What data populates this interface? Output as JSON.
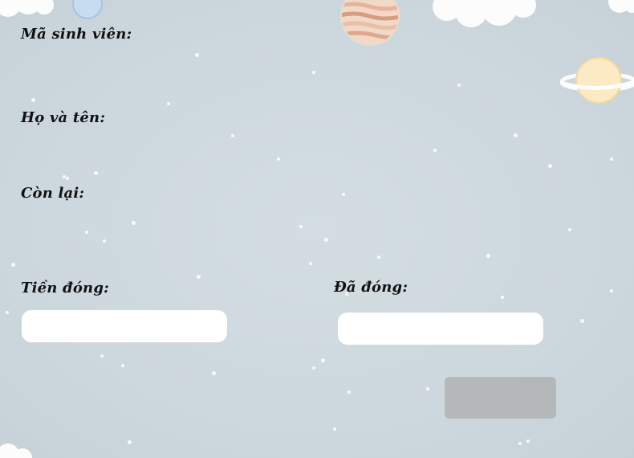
{
  "form": {
    "student_id_label": "Mã sinh viên:",
    "full_name_label": "Họ và tên:",
    "remaining_label": "Còn lại:",
    "fee_label": "Tiền đóng:",
    "paid_label": "Đã đóng:",
    "fee_value": "",
    "paid_value": "",
    "submit_label": ""
  }
}
